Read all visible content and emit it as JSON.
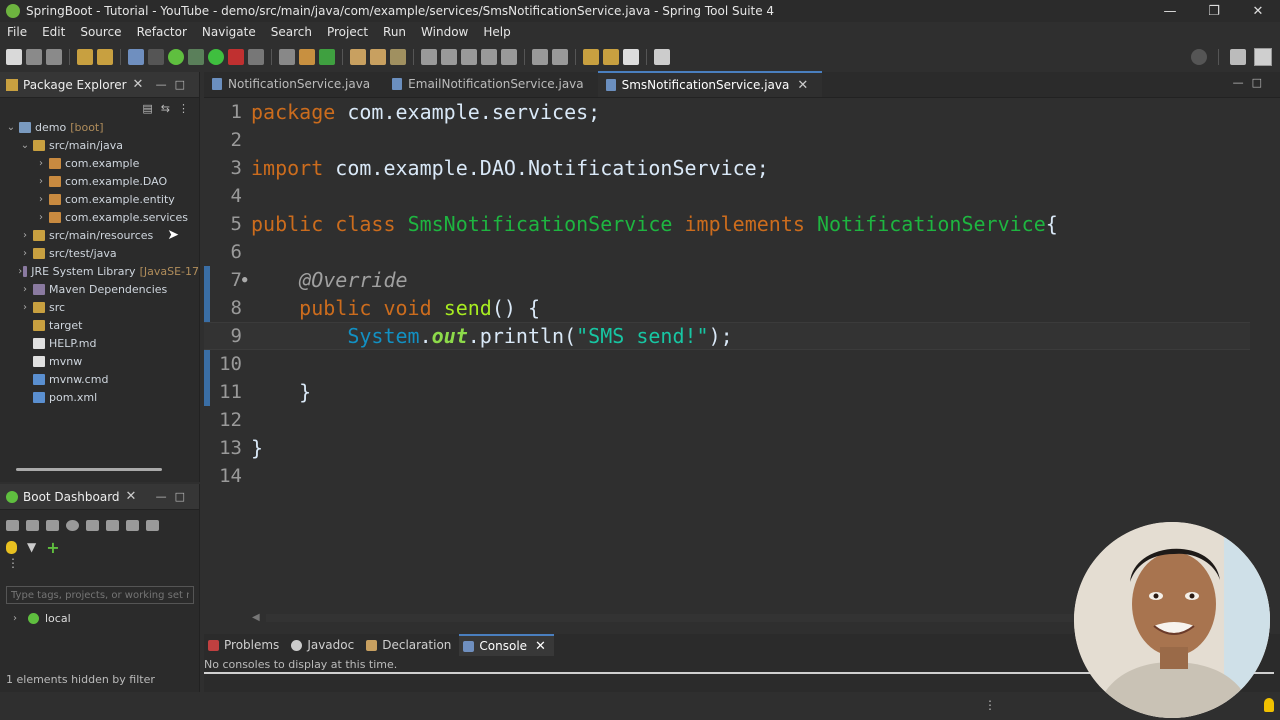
{
  "window": {
    "title": "SpringBoot - Tutorial - YouTube - demo/src/main/java/com/example/services/SmsNotificationService.java - Spring Tool Suite 4"
  },
  "menu": [
    {
      "label": "File"
    },
    {
      "label": "Edit"
    },
    {
      "label": "Source"
    },
    {
      "label": "Refactor"
    },
    {
      "label": "Navigate"
    },
    {
      "label": "Search"
    },
    {
      "label": "Project"
    },
    {
      "label": "Run"
    },
    {
      "label": "Window"
    },
    {
      "label": "Help"
    }
  ],
  "package_explorer": {
    "title": "Package Explorer",
    "tree": [
      {
        "label": "demo",
        "suffix": "[boot]"
      },
      {
        "label": "src/main/java"
      },
      {
        "label": "com.example"
      },
      {
        "label": "com.example.DAO"
      },
      {
        "label": "com.example.entity"
      },
      {
        "label": "com.example.services"
      },
      {
        "label": "src/main/resources"
      },
      {
        "label": "src/test/java"
      },
      {
        "label": "JRE System Library",
        "suffix": "[JavaSE-17"
      },
      {
        "label": "Maven Dependencies"
      },
      {
        "label": "src"
      },
      {
        "label": "target"
      },
      {
        "label": "HELP.md"
      },
      {
        "label": "mvnw"
      },
      {
        "label": "mvnw.cmd"
      },
      {
        "label": "pom.xml"
      }
    ]
  },
  "boot_dashboard": {
    "title": "Boot Dashboard",
    "search_placeholder": "Type tags, projects, or working set na",
    "local_label": "local",
    "footer": "1 elements hidden by filter"
  },
  "editor": {
    "tabs": [
      {
        "label": "NotificationService.java"
      },
      {
        "label": "EmailNotificationService.java"
      },
      {
        "label": "SmsNotificationService.java"
      }
    ],
    "line_numbers": [
      "1",
      "2",
      "3",
      "4",
      "5",
      "6",
      "7",
      "8",
      "9",
      "10",
      "11",
      "12",
      "13",
      "14"
    ],
    "code": {
      "l1_kw": "package",
      "l1_rest": " com.example.services;",
      "l3_kw": "import",
      "l3_rest": " com.example.DAO.NotificationService;",
      "l5_kw1": "public",
      "l5_kw2": "class",
      "l5_cls": "SmsNotificationService",
      "l5_kw3": "implements",
      "l5_iface": "NotificationService",
      "l5_brace": "{",
      "l7_ann": "@Override",
      "l8_kw1": "public",
      "l8_kw2": "void",
      "l8_meth": "send",
      "l8_rest": "() {",
      "l9_sys": "System",
      "l9_dot1": ".",
      "l9_out": "out",
      "l9_dot2": ".",
      "l9_meth": "println",
      "l9_open": "(",
      "l9_str": "\"SMS send!\"",
      "l9_close": ");",
      "l11": "}",
      "l13": "}"
    }
  },
  "console": {
    "tabs": [
      {
        "label": "Problems"
      },
      {
        "label": "Javadoc"
      },
      {
        "label": "Declaration"
      },
      {
        "label": "Console"
      }
    ],
    "message": "No consoles to display at this time."
  },
  "colors": {
    "keyword": "#cc6c1d",
    "class": "#1eb540",
    "string": "#17c6a3",
    "annotation": "#a0a0a0",
    "spring_green": "#6db33f"
  }
}
